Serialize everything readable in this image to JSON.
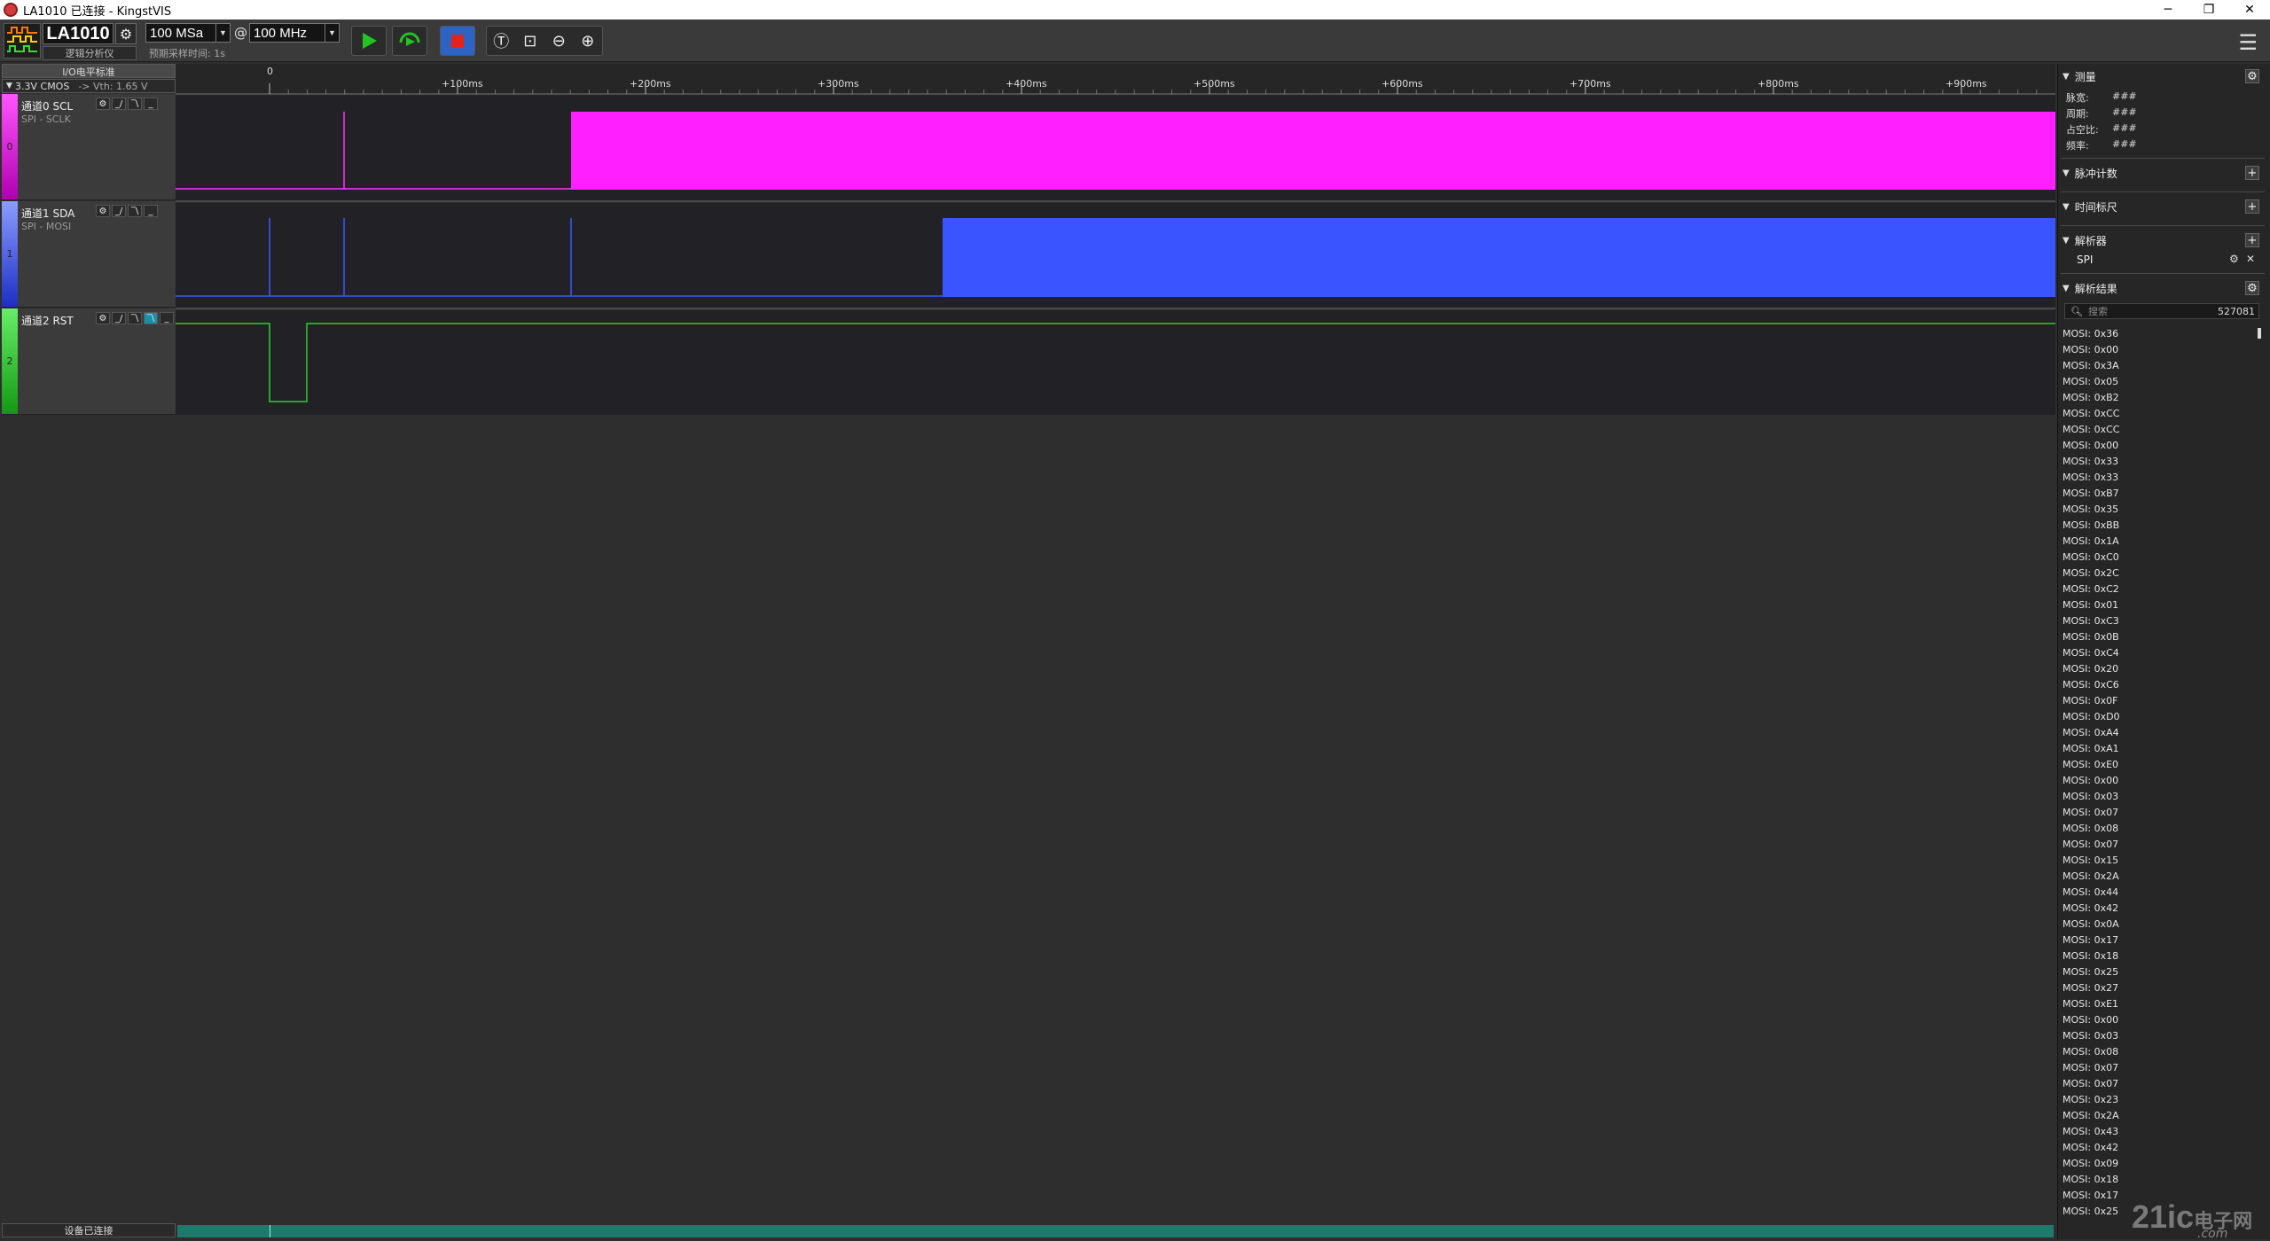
{
  "window": {
    "title": "LA1010 已连接 - KingstVIS"
  },
  "toolbar": {
    "device_name": "LA1010",
    "device_sub": "逻辑分析仪",
    "sample_rate": "100 MSa",
    "at": "@",
    "frequency": "100 MHz",
    "sample_time": "预期采样时间: 1s"
  },
  "left_panel": {
    "io_header": "I/O电平标准",
    "io_standard": "3.3V CMOS",
    "vth": "-> Vth: 1.65 V"
  },
  "channels": [
    {
      "index": "0",
      "name": "通道0 SCL",
      "protocol": "SPI - SCLK",
      "color": "#ff33ff"
    },
    {
      "index": "1",
      "name": "通道1 SDA",
      "protocol": "SPI - MOSI",
      "color": "#3b58ff"
    },
    {
      "index": "2",
      "name": "通道2 RST",
      "protocol": "",
      "color": "#33cc33"
    }
  ],
  "timeline": {
    "ticks": [
      "0",
      "+100ms",
      "+200ms",
      "+300ms",
      "+400ms",
      "+500ms",
      "+600ms",
      "+700ms",
      "+800ms",
      "+900ms"
    ]
  },
  "right_panel": {
    "measure": {
      "title": "测量",
      "rows": [
        {
          "label": "脉宽:",
          "value": "###"
        },
        {
          "label": "周期:",
          "value": "###"
        },
        {
          "label": "占空比:",
          "value": "###"
        },
        {
          "label": "频率:",
          "value": "###"
        }
      ]
    },
    "pulse_count": "脉冲计数",
    "time_ruler": "时间标尺",
    "analyzer": {
      "title": "解析器",
      "item": "SPI"
    },
    "results": {
      "title": "解析结果",
      "search_placeholder": "搜索",
      "count": "527081",
      "items": [
        "MOSI: 0x36",
        "MOSI: 0x00",
        "MOSI: 0x3A",
        "MOSI: 0x05",
        "MOSI: 0xB2",
        "MOSI: 0xCC",
        "MOSI: 0xCC",
        "MOSI: 0x00",
        "MOSI: 0x33",
        "MOSI: 0x33",
        "MOSI: 0xB7",
        "MOSI: 0x35",
        "MOSI: 0xBB",
        "MOSI: 0x1A",
        "MOSI: 0xC0",
        "MOSI: 0x2C",
        "MOSI: 0xC2",
        "MOSI: 0x01",
        "MOSI: 0xC3",
        "MOSI: 0x0B",
        "MOSI: 0xC4",
        "MOSI: 0x20",
        "MOSI: 0xC6",
        "MOSI: 0x0F",
        "MOSI: 0xD0",
        "MOSI: 0xA4",
        "MOSI: 0xA1",
        "MOSI: 0xE0",
        "MOSI: 0x00",
        "MOSI: 0x03",
        "MOSI: 0x07",
        "MOSI: 0x08",
        "MOSI: 0x07",
        "MOSI: 0x15",
        "MOSI: 0x2A",
        "MOSI: 0x44",
        "MOSI: 0x42",
        "MOSI: 0x0A",
        "MOSI: 0x17",
        "MOSI: 0x18",
        "MOSI: 0x25",
        "MOSI: 0x27",
        "MOSI: 0xE1",
        "MOSI: 0x00",
        "MOSI: 0x03",
        "MOSI: 0x08",
        "MOSI: 0x07",
        "MOSI: 0x07",
        "MOSI: 0x23",
        "MOSI: 0x2A",
        "MOSI: 0x43",
        "MOSI: 0x42",
        "MOSI: 0x09",
        "MOSI: 0x18",
        "MOSI: 0x17",
        "MOSI: 0x25"
      ]
    }
  },
  "status": {
    "device_connected": "设备已连接"
  },
  "watermark": {
    "main": "21ic",
    "sub": "电子网",
    "domain": ".com"
  }
}
